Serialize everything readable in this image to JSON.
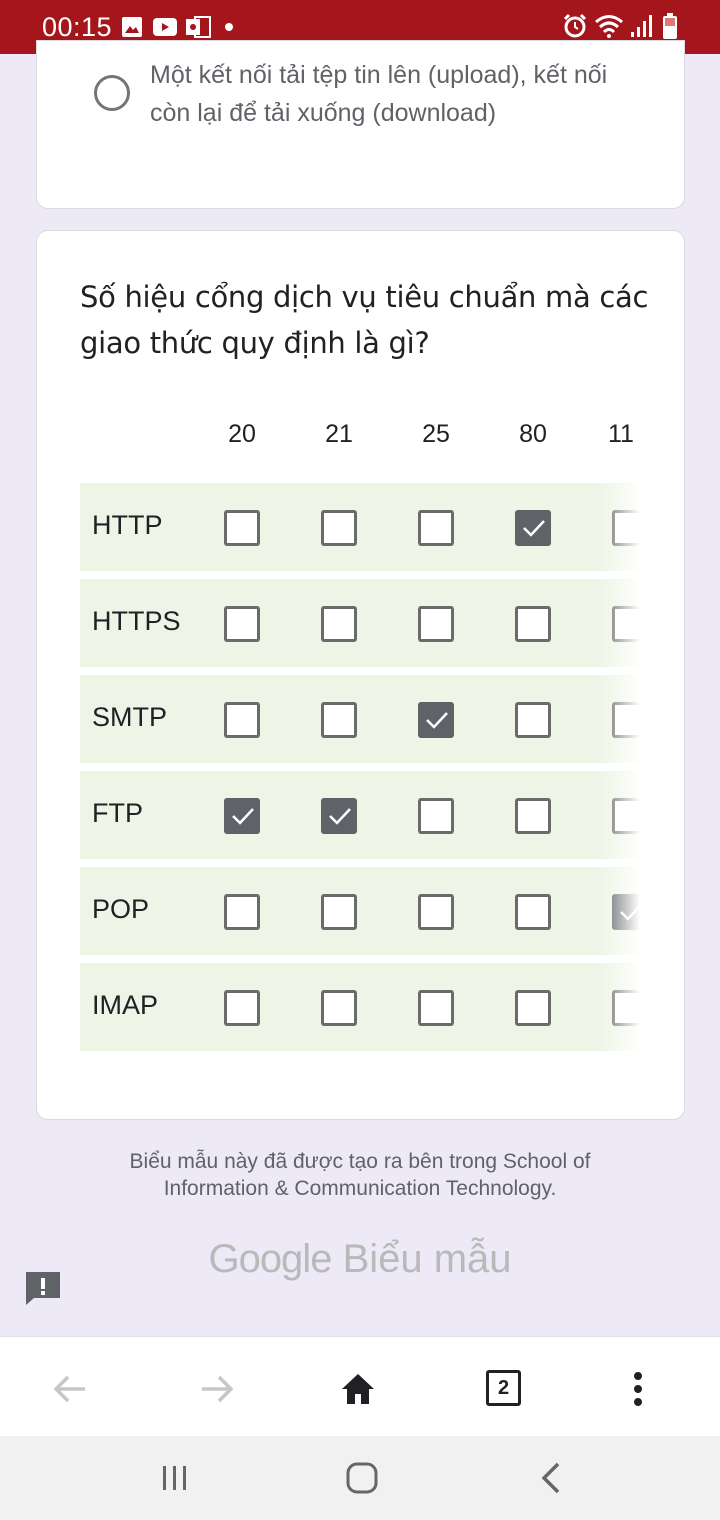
{
  "status_bar": {
    "time": "00:15",
    "left_icons": [
      "image-icon",
      "youtube-icon",
      "outlook-icon",
      "dot-icon"
    ],
    "right_icons": [
      "alarm-icon",
      "wifi-icon",
      "signal-icon",
      "battery-icon"
    ],
    "background": "#a5161c"
  },
  "previous_question": {
    "option_label": "Một kết nối tải tệp tin lên (upload), kết nối còn lại để tải xuống (download)"
  },
  "grid_question": {
    "title": "Số hiệu cổng dịch vụ tiêu chuẩn mà các giao thức quy định là gì?",
    "columns": [
      "20",
      "21",
      "25",
      "80",
      "11"
    ],
    "rows": [
      {
        "label": "HTTP",
        "checked": [
          false,
          false,
          false,
          true,
          false
        ]
      },
      {
        "label": "HTTPS",
        "checked": [
          false,
          false,
          false,
          false,
          false
        ]
      },
      {
        "label": "SMTP",
        "checked": [
          false,
          false,
          true,
          false,
          false
        ]
      },
      {
        "label": "FTP",
        "checked": [
          true,
          true,
          false,
          false,
          false
        ]
      },
      {
        "label": "POP",
        "checked": [
          false,
          false,
          false,
          false,
          true
        ]
      },
      {
        "label": "IMAP",
        "checked": [
          false,
          false,
          false,
          false,
          false
        ]
      }
    ]
  },
  "footer": {
    "note": "Biểu mẫu này đã được tạo ra bên trong School of Information & Communication Technology.",
    "brand": "Google",
    "product": "Biểu mẫu"
  },
  "browser_bar": {
    "tab_count": "2",
    "icons": [
      "back-arrow-icon",
      "forward-arrow-icon",
      "home-icon",
      "tabs-icon",
      "more-vert-icon"
    ]
  },
  "colors": {
    "accent_status": "#a5161c",
    "row_background": "#eef5e6",
    "checkbox_checked": "#5f6368",
    "page_background": "#ede9f6"
  }
}
